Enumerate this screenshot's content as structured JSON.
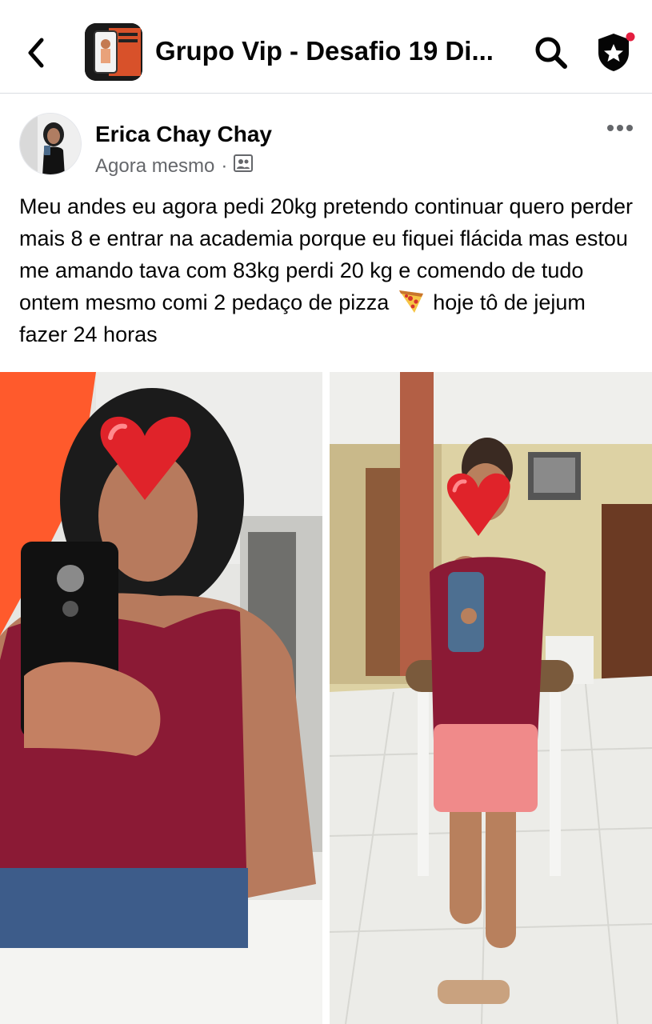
{
  "header": {
    "group_title": "Grupo Vip - Desafio 19 Di...",
    "icons": [
      "back-arrow-icon",
      "group-thumbnail",
      "search-icon",
      "admin-shield-icon"
    ]
  },
  "post": {
    "author": "Erica Chay Chay",
    "time": "Agora mesmo",
    "separator": "·",
    "audience_icon": "group-members-icon",
    "text_before_emoji": "Meu andes eu agora pedi 20kg pretendo continuar quero perder mais 8 e entrar na academia porque eu fiquei flácida mas estou me amando tava com 83kg perdi 20 kg e comendo de tudo ontem mesmo comi 2 pedaço de pizza",
    "emoji": "pizza-emoji",
    "text_after_emoji": "hoje tô de jejum fazer 24 horas",
    "photos": [
      {
        "name": "before-photo",
        "description_icon": "heart-emoji"
      },
      {
        "name": "after-photo",
        "description_icon": "heart-emoji"
      }
    ]
  },
  "colors": {
    "text_primary": "#050505",
    "text_secondary": "#65676b",
    "divider": "#dadde1",
    "notification_dot": "#e41e3f",
    "top_color": "#8b1a35",
    "shorts_color": "#f08a8a"
  }
}
